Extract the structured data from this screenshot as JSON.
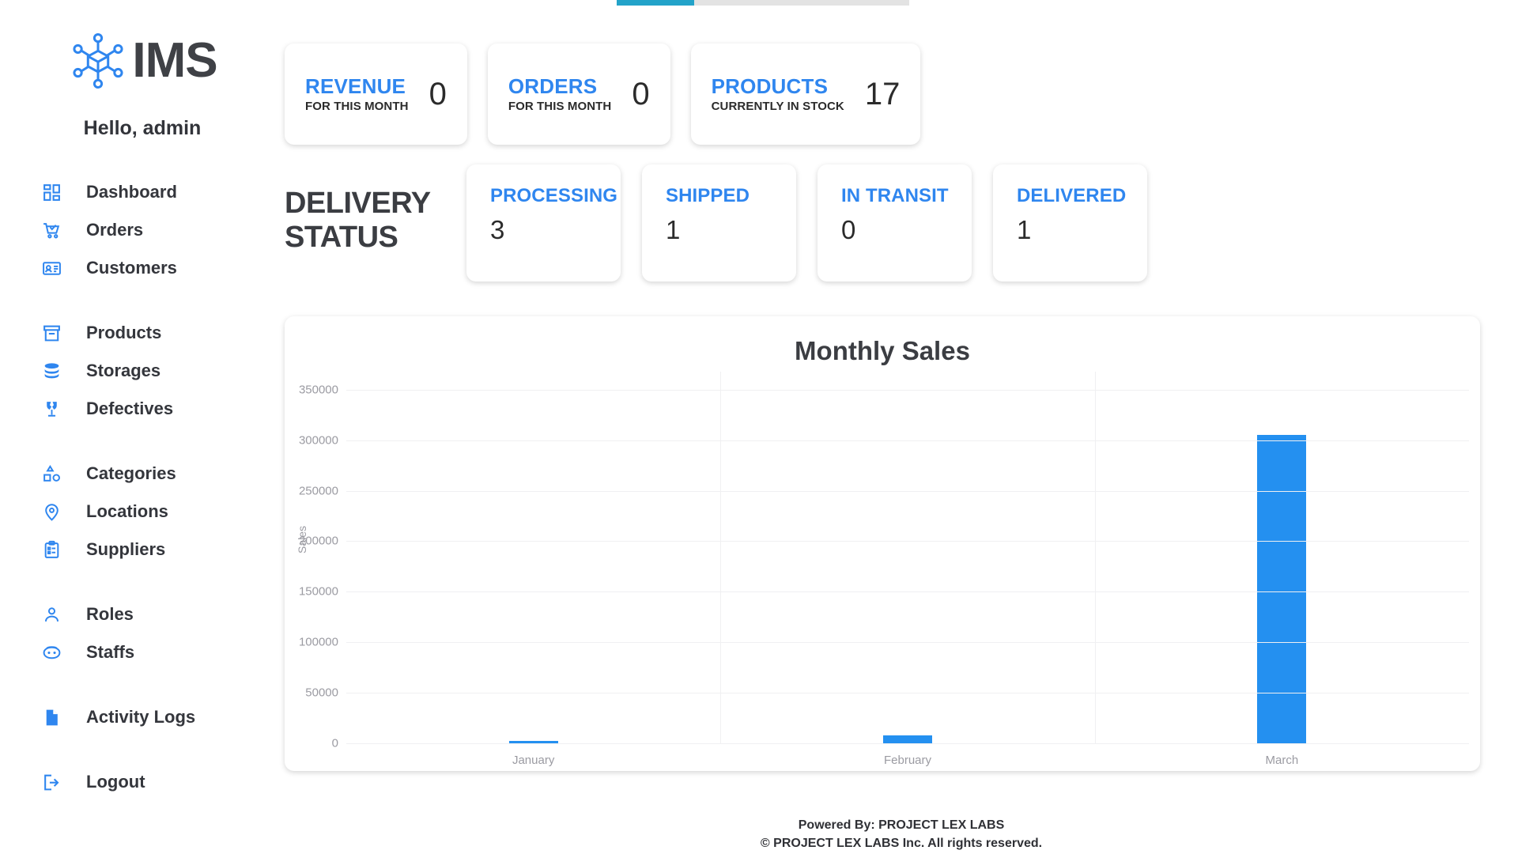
{
  "brand": {
    "name": "IMS",
    "logo_icon": "network-cube-icon"
  },
  "greeting": "Hello, admin",
  "sidebar": {
    "groups": [
      {
        "items": [
          {
            "label": "Dashboard",
            "icon": "dashboard-grid-icon"
          },
          {
            "label": "Orders",
            "icon": "shopping-cart-check-icon"
          },
          {
            "label": "Customers",
            "icon": "id-card-icon"
          }
        ]
      },
      {
        "items": [
          {
            "label": "Products",
            "icon": "box-archive-icon"
          },
          {
            "label": "Storages",
            "icon": "database-stack-icon"
          },
          {
            "label": "Defectives",
            "icon": "broken-glass-icon"
          }
        ]
      },
      {
        "items": [
          {
            "label": "Categories",
            "icon": "shapes-icon"
          },
          {
            "label": "Locations",
            "icon": "map-pin-icon"
          },
          {
            "label": "Suppliers",
            "icon": "clipboard-list-icon"
          }
        ]
      },
      {
        "items": [
          {
            "label": "Roles",
            "icon": "person-icon"
          },
          {
            "label": "Staffs",
            "icon": "face-badge-icon"
          }
        ]
      },
      {
        "items": [
          {
            "label": "Activity Logs",
            "icon": "document-icon"
          }
        ]
      },
      {
        "items": [
          {
            "label": "Logout",
            "icon": "logout-arrow-icon"
          }
        ]
      }
    ]
  },
  "stats": [
    {
      "title": "REVENUE",
      "subtitle": "FOR THIS MONTH",
      "value": "0"
    },
    {
      "title": "ORDERS",
      "subtitle": "FOR THIS MONTH",
      "value": "0"
    },
    {
      "title": "PRODUCTS",
      "subtitle": "CURRENTLY IN STOCK",
      "value": "17"
    }
  ],
  "delivery": {
    "heading_line1": "DELIVERY",
    "heading_line2": "STATUS",
    "cards": [
      {
        "title": "PROCESSING",
        "value": "3"
      },
      {
        "title": "SHIPPED",
        "value": "1"
      },
      {
        "title": "IN TRANSIT",
        "value": "0"
      },
      {
        "title": "DELIVERED",
        "value": "1"
      }
    ]
  },
  "chart_data": {
    "type": "bar",
    "title": "Monthly Sales",
    "xlabel": "",
    "ylabel": "Sales",
    "categories": [
      "January",
      "February",
      "March"
    ],
    "values": [
      2000,
      8000,
      305000
    ],
    "ylim": [
      0,
      360000
    ],
    "yticks": [
      0,
      50000,
      100000,
      150000,
      200000,
      250000,
      300000,
      350000
    ],
    "ytick_labels": [
      "0",
      "50000",
      "100000",
      "150000",
      "200000",
      "250000",
      "300000",
      "350000"
    ],
    "grid": true,
    "legend": "none",
    "bar_color": "#2490f0"
  },
  "colors": {
    "accent_blue": "#2f86ef",
    "bar_blue": "#2490f0",
    "heading_dark": "#3b3d42",
    "progress_teal": "#23a3c9"
  },
  "footer": {
    "powered_by": "Powered By: PROJECT LEX LABS",
    "copyright": "© PROJECT LEX LABS Inc. All rights reserved."
  }
}
